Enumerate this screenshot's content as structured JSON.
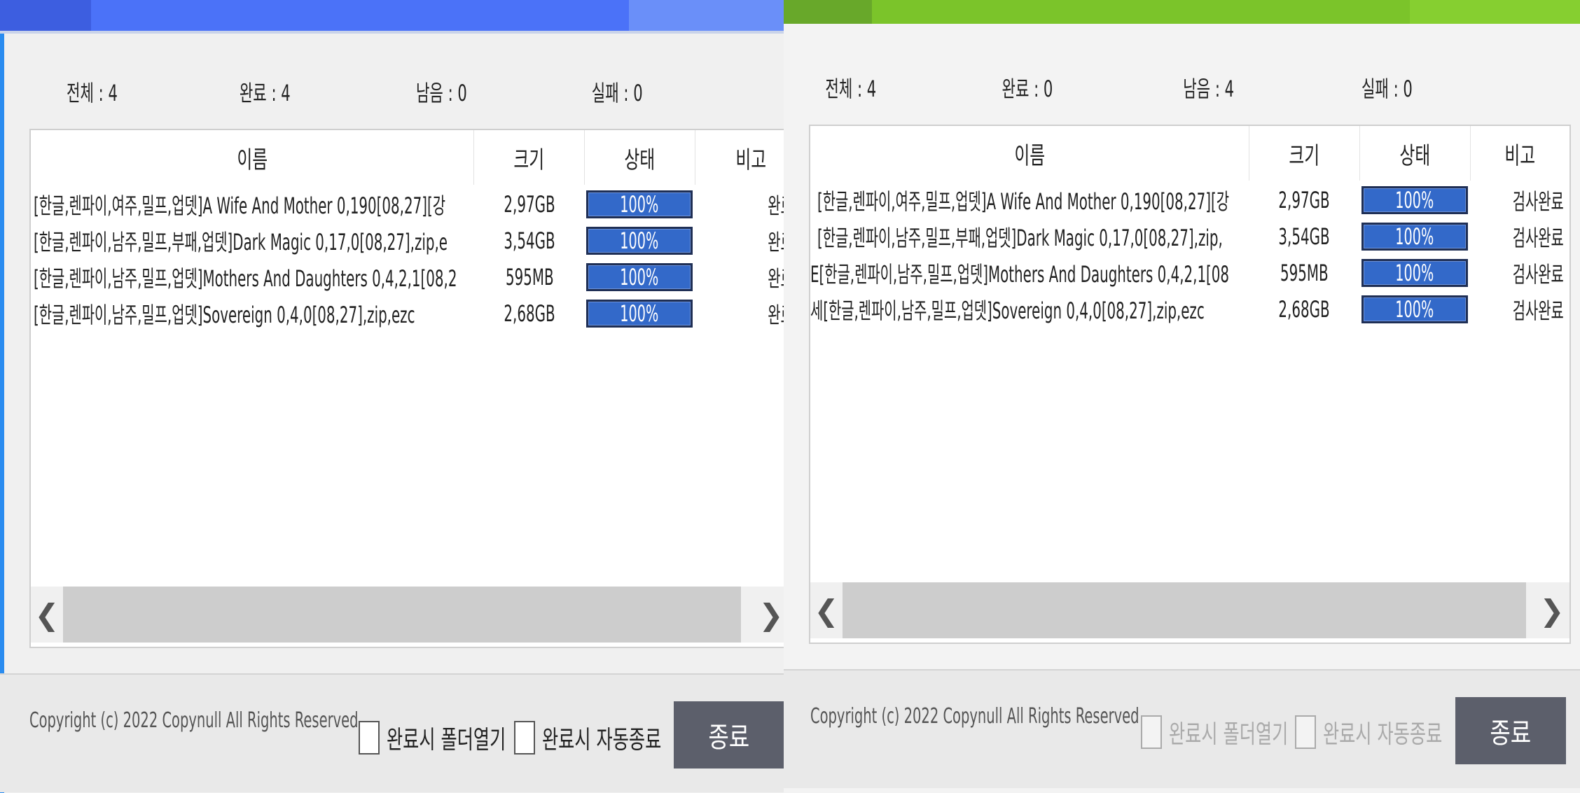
{
  "windows": [
    {
      "title_color": "#4b72f8",
      "stats": {
        "total": "전체 : 4",
        "done": "완료 : 4",
        "remaining": "남음 : 0",
        "failed": "실패 : 0"
      },
      "columns": {
        "name": "이름",
        "size": "크기",
        "status": "상태",
        "note": "비고"
      },
      "rows": [
        {
          "name": "[한글,렌파이,여주,밀프,업뎃]A Wife And Mother 0,190[08,27][강",
          "size": "2,97GB",
          "progress_label": "100%",
          "progress": 1.0,
          "note": "완료"
        },
        {
          "name": "[한글,렌파이,남주,밀프,부패,업뎃]Dark Magic 0,17,0[08,27],zip,e",
          "size": "3,54GB",
          "progress_label": "100%",
          "progress": 1.0,
          "note": "완료"
        },
        {
          "name": "[한글,렌파이,남주,밀프,업뎃]Mothers And Daughters 0,4,2,1[08,2",
          "size": "595MB",
          "progress_label": "100%",
          "progress": 1.0,
          "note": "완료"
        },
        {
          "name": "[한글,렌파이,남주,밀프,업뎃]Sovereign 0,4,0[08,27],zip,ezc",
          "size": "2,68GB",
          "progress_label": "100%",
          "progress": 1.0,
          "note": "완료"
        }
      ],
      "scroll": {
        "left_arrow": "❮",
        "right_arrow": "❯"
      },
      "footer": {
        "copyright": "Copyright (c) 2022 Copynull All Rights Reserved",
        "open_folder_label": "완료시 폴더열기",
        "auto_exit_label": "완료시 자동종료",
        "exit_label": "종료"
      }
    },
    {
      "title_color": "#7bc42a",
      "stats": {
        "total": "전체 : 4",
        "done": "완료 : 0",
        "remaining": "남음 : 4",
        "failed": "실패 : 0"
      },
      "columns": {
        "name": "이름",
        "size": "크기",
        "status": "상태",
        "note": "비고"
      },
      "rows": [
        {
          "name": "[한글,렌파이,여주,밀프,업뎃]A Wife And Mother 0,190[08,27][강",
          "size": "2,97GB",
          "progress_label": "100%",
          "progress": 1.0,
          "note": "검사완료"
        },
        {
          "name": "[한글,렌파이,남주,밀프,부패,업뎃]Dark Magic 0,17,0[08,27],zip,",
          "size": "3,54GB",
          "progress_label": "100%",
          "progress": 1.0,
          "note": "검사완료"
        },
        {
          "name": "E[한글,렌파이,남주,밀프,업뎃]Mothers And Daughters 0,4,2,1[08",
          "size": "595MB",
          "progress_label": "100%",
          "progress": 1.0,
          "note": "검사완료"
        },
        {
          "name": "세[한글,렌파이,남주,밀프,업뎃]Sovereign 0,4,0[08,27],zip,ezc",
          "size": "2,68GB",
          "progress_label": "100%",
          "progress": 1.0,
          "note": "검사완료"
        }
      ],
      "scroll": {
        "left_arrow": "❮",
        "right_arrow": "❯"
      },
      "footer": {
        "copyright": "Copyright (c) 2022 Copynull All Rights Reserved",
        "open_folder_label": "완료시 폴더열기",
        "auto_exit_label": "완료시 자동종료",
        "exit_label": "종료"
      }
    }
  ]
}
